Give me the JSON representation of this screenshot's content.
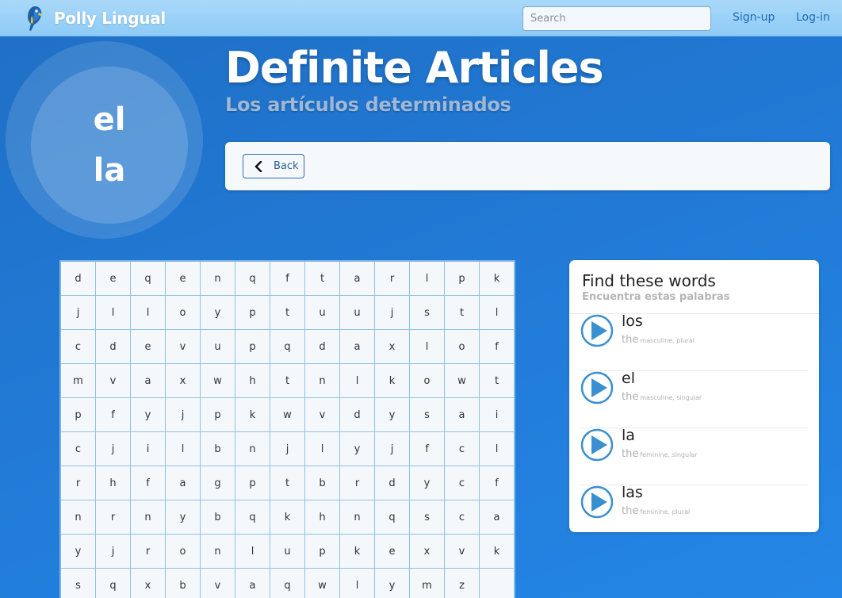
{
  "navbar": {
    "brand": "Polly Lingual",
    "search_placeholder": "Search",
    "signup": "Sign-up",
    "login": "Log-in"
  },
  "hero": {
    "circle_words": [
      "el",
      "la"
    ],
    "title": "Definite Articles",
    "subtitle": "Los artículos determinados"
  },
  "toolbar": {
    "back_label": "Back"
  },
  "word_search": {
    "rows": [
      [
        "d",
        "e",
        "q",
        "e",
        "n",
        "q",
        "f",
        "t",
        "a",
        "r",
        "l",
        "p",
        "k"
      ],
      [
        "j",
        "l",
        "l",
        "o",
        "y",
        "p",
        "t",
        "u",
        "u",
        "j",
        "s",
        "t",
        "l"
      ],
      [
        "c",
        "d",
        "e",
        "v",
        "u",
        "p",
        "q",
        "d",
        "a",
        "x",
        "l",
        "o",
        "f"
      ],
      [
        "m",
        "v",
        "a",
        "x",
        "w",
        "h",
        "t",
        "n",
        "l",
        "k",
        "o",
        "w",
        "t"
      ],
      [
        "p",
        "f",
        "y",
        "j",
        "p",
        "k",
        "w",
        "v",
        "d",
        "y",
        "s",
        "a",
        "i"
      ],
      [
        "c",
        "j",
        "i",
        "l",
        "b",
        "n",
        "j",
        "l",
        "y",
        "j",
        "f",
        "c",
        "l"
      ],
      [
        "r",
        "h",
        "f",
        "a",
        "g",
        "p",
        "t",
        "b",
        "r",
        "d",
        "y",
        "c",
        "f"
      ],
      [
        "n",
        "r",
        "n",
        "y",
        "b",
        "q",
        "k",
        "h",
        "n",
        "q",
        "s",
        "c",
        "a"
      ],
      [
        "y",
        "j",
        "r",
        "o",
        "n",
        "l",
        "u",
        "p",
        "k",
        "e",
        "x",
        "v",
        "k"
      ],
      [
        "s",
        "q",
        "x",
        "b",
        "v",
        "a",
        "q",
        "w",
        "l",
        "y",
        "m",
        "z",
        ""
      ]
    ]
  },
  "find_words": {
    "title": "Find these words",
    "subtitle": "Encuentra estas palabras",
    "items": [
      {
        "word": "los",
        "translation": "the",
        "note": "masculine, plural"
      },
      {
        "word": "el",
        "translation": "the",
        "note": "masculine, singular"
      },
      {
        "word": "la",
        "translation": "the",
        "note": "feminine, singular"
      },
      {
        "word": "las",
        "translation": "the",
        "note": "feminine, plural"
      }
    ]
  },
  "colors": {
    "accent": "#3a8fd0",
    "navbar": "#9fd3f8",
    "background": "#2178d3"
  },
  "icons": {
    "brand": "parrot-icon",
    "back": "chevron-left-icon",
    "play": "play-icon"
  }
}
